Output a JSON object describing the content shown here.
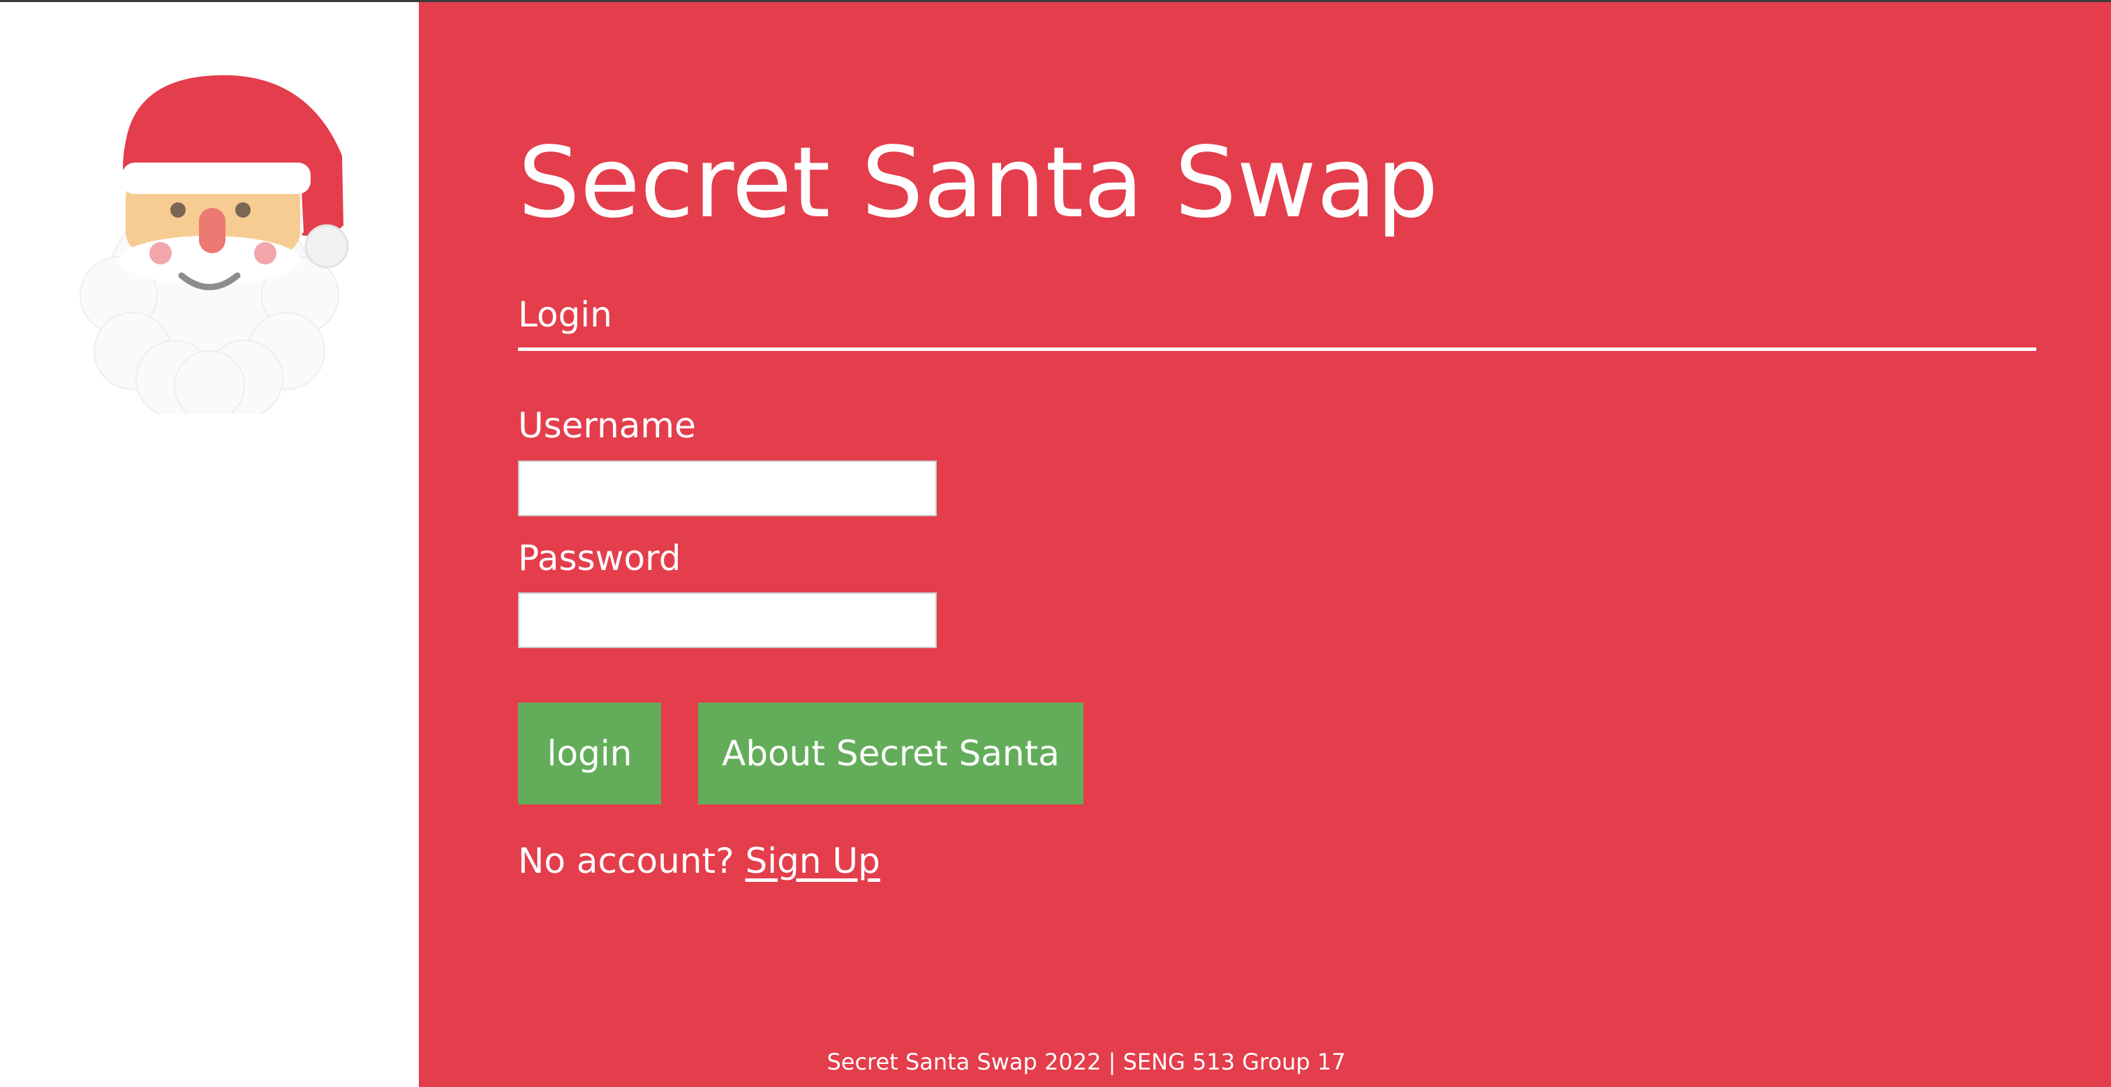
{
  "app": {
    "title": "Secret Santa Swap"
  },
  "sidebar": {
    "logo_icon": "santa-face-icon"
  },
  "login": {
    "section_label": "Login",
    "username_label": "Username",
    "username_value": "",
    "password_label": "Password",
    "password_value": "",
    "login_button": "login",
    "about_button": "About Secret Santa",
    "no_account_text": "No account?",
    "signup_link": "Sign Up"
  },
  "footer": {
    "text": "Secret Santa Swap 2022 | SENG 513 Group 17"
  },
  "colors": {
    "main_background": "#e43d4b",
    "button_green": "#63ad5a",
    "sidebar_background": "#ffffff",
    "text": "#ffffff"
  }
}
